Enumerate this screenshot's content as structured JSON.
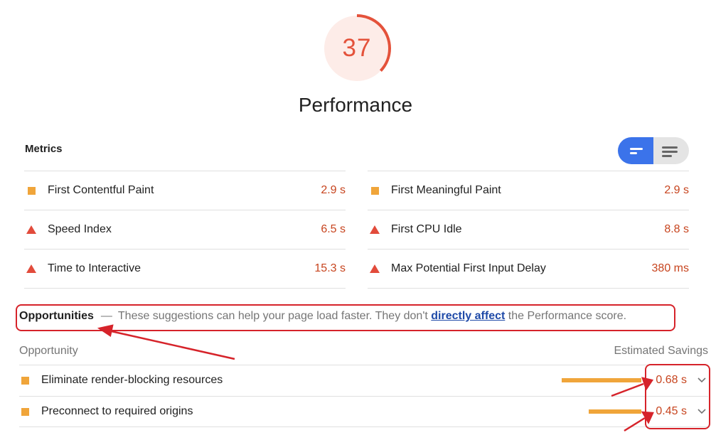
{
  "gauge": {
    "score": "37",
    "fraction": 0.37,
    "color": "#e4523b"
  },
  "title": "Performance",
  "metrics": {
    "heading": "Metrics",
    "left": [
      {
        "icon": "square",
        "label": "First Contentful Paint",
        "value": "2.9 s"
      },
      {
        "icon": "triangle",
        "label": "Speed Index",
        "value": "6.5 s"
      },
      {
        "icon": "triangle",
        "label": "Time to Interactive",
        "value": "15.3 s"
      }
    ],
    "right": [
      {
        "icon": "square",
        "label": "First Meaningful Paint",
        "value": "2.9 s"
      },
      {
        "icon": "triangle",
        "label": "First CPU Idle",
        "value": "8.8 s"
      },
      {
        "icon": "triangle",
        "label": "Max Potential First Input Delay",
        "value": "380 ms"
      }
    ]
  },
  "opportunities": {
    "title": "Opportunities",
    "dash": "—",
    "desc_before": "These suggestions can help your page load faster. They don't",
    "link": "directly affect",
    "desc_after": "the Performance score.",
    "col_left": "Opportunity",
    "col_right": "Estimated Savings",
    "items": [
      {
        "label": "Eliminate render-blocking resources",
        "value": "0.68 s",
        "savings_seconds": 0.68
      },
      {
        "label": "Preconnect to required origins",
        "value": "0.45 s",
        "savings_seconds": 0.45
      }
    ]
  },
  "colors": {
    "average": "#f0a53a",
    "fail": "#e24b3b",
    "annotation": "#d6232a",
    "toggle_active": "#3b73ea",
    "link": "#1f4aa8"
  }
}
